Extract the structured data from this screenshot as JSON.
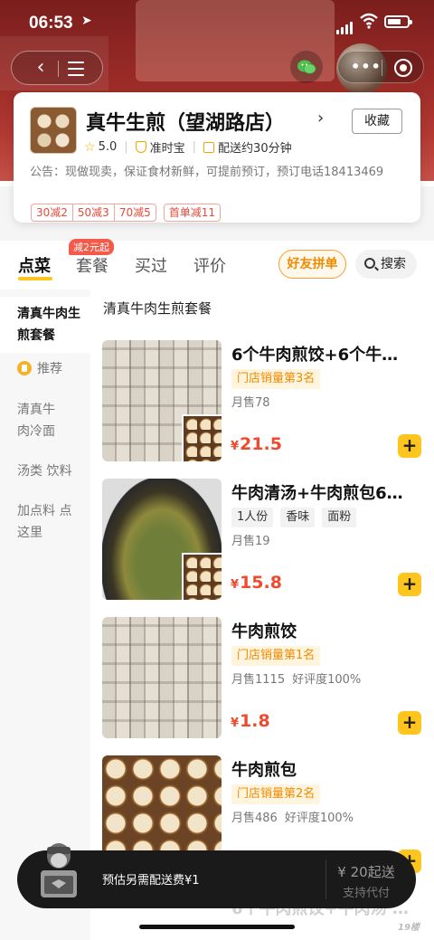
{
  "status_bar": {
    "time": "06:53"
  },
  "shop": {
    "name": "真牛生煎（望湖路店）",
    "favorite_label": "收藏",
    "rating": "5.0",
    "badge_on_time": "准时宝",
    "delivery_time": "配送约30分钟",
    "notice": "公告：现做现卖，保证食材新鲜，可提前预订，预订电话18413469"
  },
  "promotions": {
    "discounts": [
      "30减2",
      "50减3",
      "70减5"
    ],
    "first_order": "首单减11"
  },
  "tabs": {
    "items": [
      "点菜",
      "套餐",
      "买过",
      "评价"
    ],
    "badge": "减2元起",
    "group_order": "好友拼单",
    "search": "搜索"
  },
  "sidebar": {
    "items": [
      "清真牛肉生煎套餐",
      "推荐",
      "清真牛肉冷面",
      "汤类 饮料",
      "加点料 点这里"
    ]
  },
  "section_title": "清真牛肉生煎套餐",
  "menu_items": [
    {
      "name": "6个牛肉煎饺+6个牛…",
      "rank": "门店销量第3名",
      "sales": "月售78",
      "rating": "",
      "price": "21.5",
      "currency": "¥"
    },
    {
      "name": "牛肉清汤+牛肉煎包6…",
      "tags": [
        "1人份",
        "香味",
        "面粉"
      ],
      "sales": "月售19",
      "rating": "",
      "price": "15.8",
      "currency": "¥"
    },
    {
      "name": "牛肉煎饺",
      "rank": "门店销量第1名",
      "sales": "月售1115",
      "rating": "好评度100%",
      "price": "1.8",
      "currency": "¥"
    },
    {
      "name": "牛肉煎包",
      "rank": "门店销量第2名",
      "sales": "月售486",
      "rating": "好评度100%",
      "price": "",
      "currency": "¥"
    }
  ],
  "next_item_partial": "6个牛肉煎饺+牛肉汤 …",
  "cart": {
    "fee_note": "预估另需配送费¥1",
    "min_order": "¥ 20起送",
    "pay_label": "支持代付"
  },
  "watermark": "19楼",
  "colors": {
    "accent": "#ffc51f",
    "price": "#f04a2e",
    "promo": "#e24a3b",
    "hero": "#9b2b27"
  }
}
